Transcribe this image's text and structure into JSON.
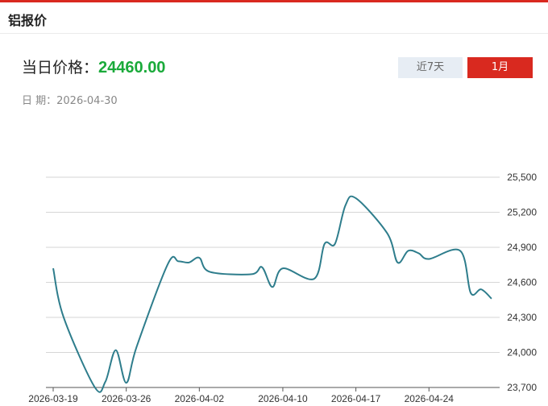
{
  "header": {
    "title": "铝报价"
  },
  "price": {
    "label": "当日价格：",
    "value": "24460.00"
  },
  "date": {
    "label": "日 期：",
    "value": "2026-04-30"
  },
  "buttons": {
    "week": "近7天",
    "month": "1月"
  },
  "colors": {
    "line": "#2e7d8c",
    "accent": "#d9291f",
    "price": "#1aaa3a",
    "grid": "#d6d6d6"
  },
  "chart_data": {
    "type": "line",
    "title": "",
    "xlabel": "",
    "ylabel": "",
    "ylim": [
      23700,
      25500
    ],
    "y_ticks": [
      23700,
      24000,
      24300,
      24600,
      24900,
      25200,
      25500
    ],
    "y_tick_labels": [
      "23,700",
      "24,000",
      "24,300",
      "24,600",
      "24,900",
      "25,200",
      "25,500"
    ],
    "x_tick_labels": [
      "2026-03-19",
      "2026-03-26",
      "2026-04-02",
      "2026-04-10",
      "2026-04-17",
      "2026-04-24"
    ],
    "grid": true,
    "x": [
      "2026-03-19",
      "2026-03-20",
      "2026-03-23",
      "2026-03-24",
      "2026-03-25",
      "2026-03-26",
      "2026-03-27",
      "2026-03-30",
      "2026-03-31",
      "2026-04-01",
      "2026-04-02",
      "2026-04-03",
      "2026-04-07",
      "2026-04-08",
      "2026-04-09",
      "2026-04-10",
      "2026-04-13",
      "2026-04-14",
      "2026-04-15",
      "2026-04-16",
      "2026-04-17",
      "2026-04-20",
      "2026-04-21",
      "2026-04-22",
      "2026-04-23",
      "2026-04-24",
      "2026-04-27",
      "2026-04-28",
      "2026-04-29",
      "2026-04-30"
    ],
    "series": [
      {
        "values": [
          24720,
          24300,
          23700,
          23750,
          24020,
          23740,
          24050,
          24760,
          24780,
          24770,
          24810,
          24690,
          24670,
          24730,
          24560,
          24720,
          24630,
          24930,
          24930,
          25260,
          25320,
          25020,
          24770,
          24870,
          24850,
          24800,
          24870,
          24510,
          24540,
          24460
        ]
      }
    ]
  }
}
